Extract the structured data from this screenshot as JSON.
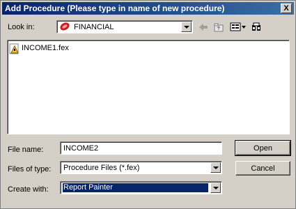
{
  "window": {
    "title": "Add Procedure (Please type in name of new procedure)",
    "close_label": "X"
  },
  "look_in": {
    "label": "Look in:",
    "value": "FINANCIAL"
  },
  "files": [
    {
      "name": "INCOME1.fex"
    }
  ],
  "file_name": {
    "label": "File name:",
    "value": "INCOME2"
  },
  "files_of_type": {
    "label": "Files of type:",
    "value": "Procedure Files (*.fex)"
  },
  "create_with": {
    "label": "Create with:",
    "value": "Report Painter"
  },
  "buttons": {
    "open": "Open",
    "cancel": "Cancel"
  },
  "toolbar_icons": [
    "back-arrow-icon",
    "up-folder-icon",
    "view-menu-icon",
    "properties-icon"
  ]
}
